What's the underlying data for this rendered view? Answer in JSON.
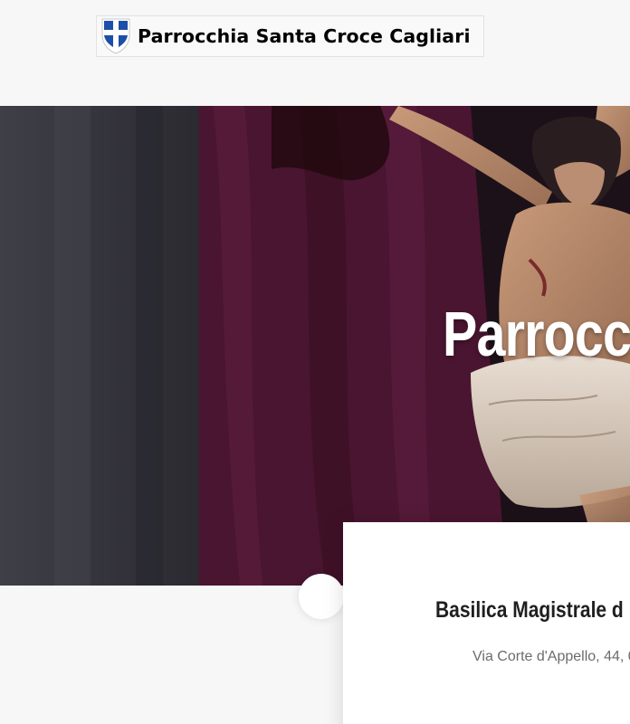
{
  "header": {
    "site_name": "Parrocchia Santa Croce Cagliari",
    "logo_icon": "shield-cross-icon",
    "colors": {
      "shield_blue": "#1c4fa8",
      "shield_white": "#ffffff"
    }
  },
  "hero": {
    "title": "Parrocc",
    "image_subject": "crucifix statue in front of crimson drapery",
    "colors": {
      "drape": "#4c1733",
      "wall": "#34343d"
    }
  },
  "card": {
    "title": "Basilica Magistrale d",
    "address": "Via Corte d'Appello, 44, 0"
  }
}
